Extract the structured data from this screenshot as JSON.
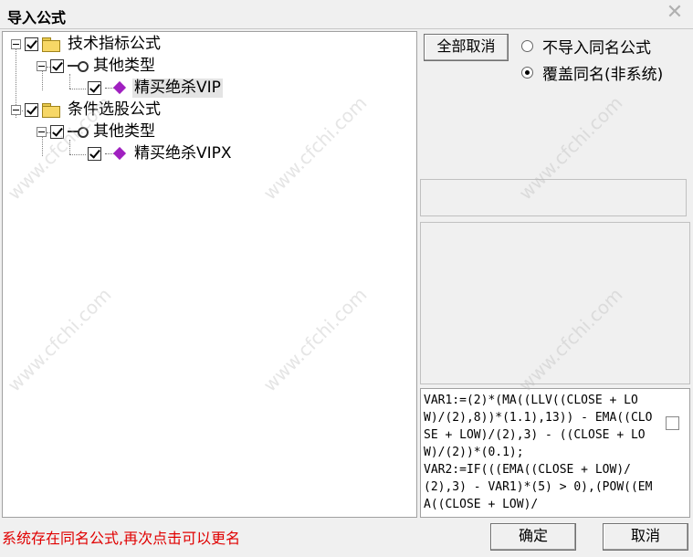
{
  "window": {
    "title": "导入公式",
    "close_icon": "close-icon"
  },
  "tree": {
    "groups": [
      {
        "label": "技术指标公式",
        "checked": true,
        "subgroup": {
          "label": "其他类型",
          "checked": true,
          "item": {
            "label": "精买绝杀VIP",
            "checked": true,
            "selected": true
          }
        }
      },
      {
        "label": "条件选股公式",
        "checked": true,
        "subgroup": {
          "label": "其他类型",
          "checked": true,
          "item": {
            "label": "精买绝杀VIPX",
            "checked": true,
            "selected": false
          }
        }
      }
    ]
  },
  "options": {
    "cancel_all_label": "全部取消",
    "radio_no_import": "不导入同名公式",
    "radio_overwrite": "覆盖同名(非系统)",
    "selected": "overwrite"
  },
  "code": "VAR1:=(2)*(MA((LLV((CLOSE + LOW)/(2),8))*(1.1),13)) - EMA((CLOSE + LOW)/(2),3) - ((CLOSE + LOW)/(2))*(0.1);\nVAR2:=IF(((EMA((CLOSE + LOW)/(2),3) - VAR1)*(5) > 0),(POW((EMA((CLOSE + LOW)/",
  "status": "系统存在同名公式,再次点击可以更名",
  "buttons": {
    "ok": "确定",
    "cancel": "取消"
  },
  "watermark": "www.cfchi.com"
}
